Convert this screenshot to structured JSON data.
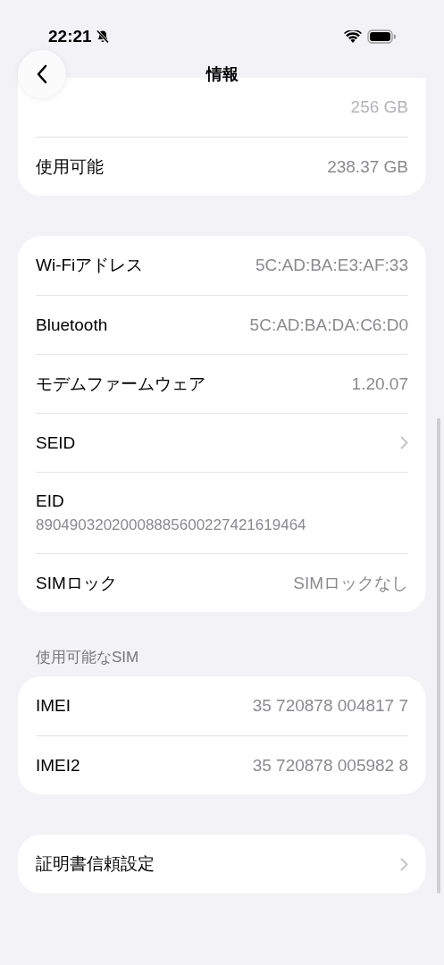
{
  "status_bar": {
    "time": "22:21"
  },
  "nav": {
    "title": "情報"
  },
  "groups": [
    {
      "rows": [
        {
          "kind": "obscured",
          "value": "256 GB"
        },
        {
          "kind": "value",
          "label": "使用可能",
          "value": "238.37 GB"
        }
      ]
    },
    {
      "rows": [
        {
          "kind": "value",
          "label": "Wi-Fiアドレス",
          "value": "5C:AD:BA:E3:AF:33"
        },
        {
          "kind": "value",
          "label": "Bluetooth",
          "value": "5C:AD:BA:DA:C6:D0"
        },
        {
          "kind": "value",
          "label": "モデムファームウェア",
          "value": "1.20.07"
        },
        {
          "kind": "link",
          "label": "SEID"
        },
        {
          "kind": "stacked",
          "label": "EID",
          "value": "89049032020008885600227421619464"
        },
        {
          "kind": "value",
          "label": "SIMロック",
          "value": "SIMロックなし"
        }
      ]
    },
    {
      "header": "使用可能なSIM",
      "rows": [
        {
          "kind": "value",
          "label": "IMEI",
          "value": "35 720878 004817 7"
        },
        {
          "kind": "value",
          "label": "IMEI2",
          "value": "35 720878 005982 8"
        }
      ]
    },
    {
      "rows": [
        {
          "kind": "link",
          "label": "証明書信頼設定"
        }
      ]
    }
  ]
}
